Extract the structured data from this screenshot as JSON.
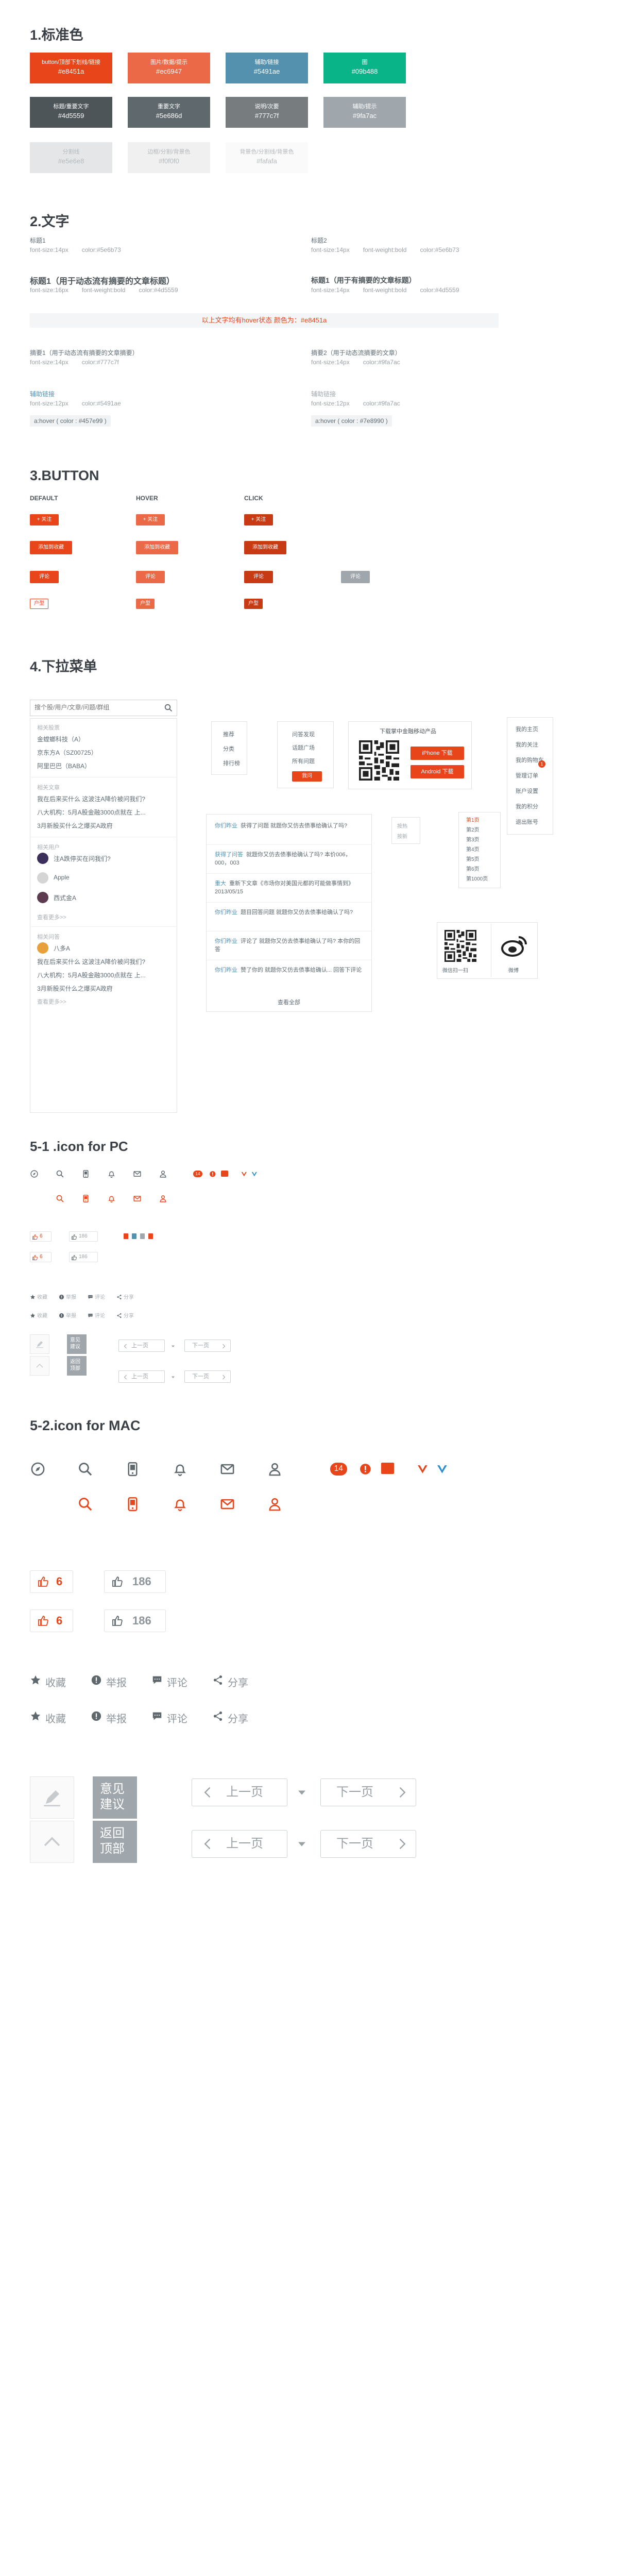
{
  "sections": {
    "colors": "1.标准色",
    "text": "2.文字",
    "button": "3.BUTTON",
    "dropdown": "4.下拉菜单",
    "icon_pc": "5-1 .icon for PC",
    "icon_mac": "5-2.icon for MAC"
  },
  "colors": [
    {
      "label": "button/顶部下划线/链接",
      "hex": "#e8451a",
      "bg": "#e8451a"
    },
    {
      "label": "图片/数据/提示",
      "hex": "#ec6947",
      "bg": "#ec6947"
    },
    {
      "label": "辅助/链接",
      "hex": "#5491ae",
      "bg": "#5491ae"
    },
    {
      "label": "图",
      "hex": "#09b488",
      "bg": "#09b488"
    },
    {
      "label": "标题/重要文字",
      "hex": "#4d5559",
      "bg": "#4d5559"
    },
    {
      "label": "重要文字",
      "hex": "#5e686d",
      "bg": "#5e686d"
    },
    {
      "label": "说明/次要",
      "hex": "#777c7f",
      "bg": "#777c7f"
    },
    {
      "label": "辅助/提示",
      "hex": "#9fa7ac",
      "bg": "#9fa7ac"
    },
    {
      "label": "分割线",
      "hex": "#e5e6e8",
      "bg": "#e5e6e8"
    },
    {
      "label": "边框/分割/背景色",
      "hex": "#f0f0f0",
      "bg": "#f0f0f0"
    },
    {
      "label": "背景色/分割线/背景色",
      "hex": "#fafafa",
      "bg": "#fafafa"
    }
  ],
  "text": {
    "t1": "标题1",
    "t1_meta": [
      "font-size:14px",
      "color:#5e6b73"
    ],
    "t2": "标题2",
    "t2_meta": [
      "font-size:14px",
      "font-weight:bold",
      "color:#5e6b73"
    ],
    "t3": "标题1（用于动态流有摘要的文章标题）",
    "t3_meta": [
      "font-size:16px",
      "font-weight:bold",
      "color:#4d5559"
    ],
    "t4": "标题1（用于有摘要的文章标题）",
    "t4_meta": [
      "font-size:14px",
      "font-weight:bold",
      "color:#4d5559"
    ],
    "hover_note": "以上文字均有hover状态 颜色为：#e8451a",
    "t5": "摘要1（用于动态流有摘要的文章摘要）",
    "t5_meta": [
      "font-size:14px",
      "color:#777c7f"
    ],
    "t6": "摘要2（用于动态流摘要的文章）",
    "t6_meta": [
      "font-size:14px",
      "color:#9fa7ac"
    ],
    "t7": "辅助链接",
    "t7_meta": [
      "font-size:12px",
      "color:#5491ae"
    ],
    "t7_hover": "a:hover ( color : #457e99 )",
    "t8": "辅助链接",
    "t8_meta": [
      "font-size:12px",
      "color:#9fa7ac"
    ],
    "t8_hover": "a:hover ( color : #7e8990 )"
  },
  "buttons": {
    "headers": [
      "DEFAULT",
      "HOVER",
      "CLICK"
    ],
    "follow": "+ 关注",
    "add": "添加到收藏",
    "comment": "评论",
    "tag": "户型"
  },
  "dropdown": {
    "search_placeholder": "搜个股/用户/文章/问题/群组",
    "groups": [
      {
        "title": "相关股票",
        "items": [
          "金螳螂科技（A）",
          "京东方A（SZ00725）",
          "阿里巴巴（BABA）"
        ]
      },
      {
        "title": "相关文章",
        "items": [
          "我在后来买什么 这波注A降价被问我们?",
          "八大机构：5月A股金融3000点就在 上...",
          "3月新股买什么之爆买A政府"
        ]
      },
      {
        "title": "相关用户",
        "items": [
          "注A跌停买在问我们?",
          "Apple",
          "西式金A"
        ]
      },
      {
        "title": "相关问答",
        "items": [
          "八多A",
          "我在后来买什么 这波注A降价被问我们?",
          "八大机构：5月A股金融3000点就在 上...",
          "3月新股买什么之爆买A政府"
        ]
      }
    ],
    "more": "查看更多>>",
    "menu1": [
      "推荐",
      "分类",
      "排行榜"
    ],
    "menu2": [
      "问答发现",
      "话题广场",
      "所有问题"
    ],
    "menu2_btn": "我问",
    "app_title": "下载掌中金融移动产品",
    "app_iphone": "iPhone 下载",
    "app_android": "Android 下载",
    "user_menu": [
      "我的主页",
      "我的关注",
      "我的购物车",
      "管理订单",
      "账户设置",
      "我的积分",
      "退出账号"
    ],
    "notify": [
      {
        "user": "你们昨业",
        "text": "获得了问题 就题你又仿去债事给确认了吗?"
      },
      {
        "user": "获得了问答",
        "text": "就题你又仿去债事给确认了吗? 本价006，000，003"
      },
      {
        "user": "重大",
        "text": "重新下文章《市场你对美国元都的可能做事情到》2013/05/15"
      },
      {
        "user": "你们昨业",
        "text": "题目回答问题 就题你又仿去债事给确认了吗?"
      },
      {
        "user": "你们昨业",
        "text": "评论了 就题你又仿去债事给确认了吗? 本你的回答"
      },
      {
        "user": "你们昨业",
        "text": "赞了你的 就题你又仿去债事给确认... 回答下评论"
      }
    ],
    "notify_more": "查看全部",
    "sort_items": [
      "按热",
      "按新"
    ],
    "sort_list": [
      "第1页",
      "第2页",
      "第3页",
      "第4页",
      "第5页",
      "第6页",
      "第1000页"
    ],
    "share_wechat": "微信扫一扫",
    "share_weibo": "微博"
  },
  "pc": {
    "count_red": "6",
    "count_gray": "186",
    "actions": [
      "收藏",
      "举报",
      "评论",
      "分享"
    ],
    "feedback": "意见建议",
    "backtop": "返回顶部",
    "prev": "上一页",
    "next": "下一页",
    "badge": "14"
  },
  "mac": {
    "count_red": "6",
    "count_gray": "186",
    "actions": [
      "收藏",
      "举报",
      "评论",
      "分享"
    ],
    "feedback": "意见建议",
    "backtop": "返回顶部",
    "prev": "上一页",
    "next": "下一页",
    "badge": "14",
    "badge2": "1"
  }
}
